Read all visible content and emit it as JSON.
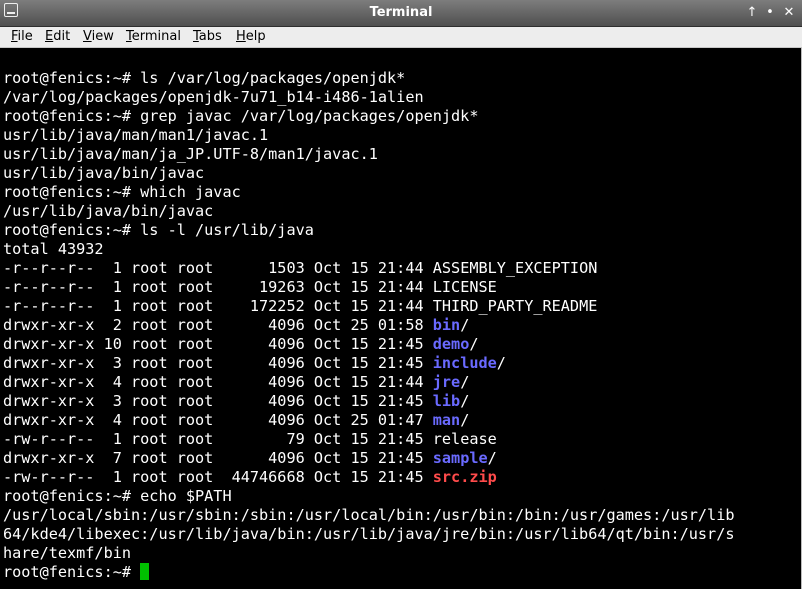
{
  "window": {
    "title": "Terminal",
    "controls": {
      "up": "↑",
      "restore": "•",
      "close": "✕"
    }
  },
  "menu": [
    {
      "label_u": "F",
      "label_rest": "ile"
    },
    {
      "label_u": "E",
      "label_rest": "dit"
    },
    {
      "label_u": "V",
      "label_rest": "iew"
    },
    {
      "label_u": "T",
      "label_rest": "erminal"
    },
    {
      "label_u": "T",
      "label_rest": "abs"
    },
    {
      "label_u": "H",
      "label_rest": "elp"
    }
  ],
  "terminal": {
    "prompt": "root@fenics:~# ",
    "lines": [
      {
        "t": "root@fenics:~# ls /var/log/packages/openjdk*"
      },
      {
        "t": "/var/log/packages/openjdk-7u71_b14-i486-1alien"
      },
      {
        "t": "root@fenics:~# grep javac /var/log/packages/openjdk*"
      },
      {
        "t": "usr/lib/java/man/man1/javac.1"
      },
      {
        "t": "usr/lib/java/man/ja_JP.UTF-8/man1/javac.1"
      },
      {
        "t": "usr/lib/java/bin/javac"
      },
      {
        "t": "root@fenics:~# which javac"
      },
      {
        "t": "/usr/lib/java/bin/javac"
      },
      {
        "t": "root@fenics:~# ls -l /usr/lib/java"
      },
      {
        "t": "total 43932"
      },
      {
        "pre": "-r--r--r--  1 root root      1503 Oct 15 21:44 ",
        "name": "ASSEMBLY_EXCEPTION",
        "kind": "file"
      },
      {
        "pre": "-r--r--r--  1 root root     19263 Oct 15 21:44 ",
        "name": "LICENSE",
        "kind": "file"
      },
      {
        "pre": "-r--r--r--  1 root root    172252 Oct 15 21:44 ",
        "name": "THIRD_PARTY_README",
        "kind": "file"
      },
      {
        "pre": "drwxr-xr-x  2 root root      4096 Oct 25 01:58 ",
        "name": "bin",
        "kind": "dir"
      },
      {
        "pre": "drwxr-xr-x 10 root root      4096 Oct 15 21:45 ",
        "name": "demo",
        "kind": "dir"
      },
      {
        "pre": "drwxr-xr-x  3 root root      4096 Oct 15 21:45 ",
        "name": "include",
        "kind": "dir"
      },
      {
        "pre": "drwxr-xr-x  4 root root      4096 Oct 15 21:44 ",
        "name": "jre",
        "kind": "dir"
      },
      {
        "pre": "drwxr-xr-x  3 root root      4096 Oct 15 21:45 ",
        "name": "lib",
        "kind": "dir"
      },
      {
        "pre": "drwxr-xr-x  4 root root      4096 Oct 25 01:47 ",
        "name": "man",
        "kind": "dir"
      },
      {
        "pre": "-rw-r--r--  1 root root        79 Oct 15 21:45 ",
        "name": "release",
        "kind": "file"
      },
      {
        "pre": "drwxr-xr-x  7 root root      4096 Oct 15 21:45 ",
        "name": "sample",
        "kind": "dir"
      },
      {
        "pre": "-rw-r--r--  1 root root  44746668 Oct 15 21:45 ",
        "name": "src.zip",
        "kind": "archive"
      },
      {
        "t": "root@fenics:~# echo $PATH"
      },
      {
        "t": "/usr/local/sbin:/usr/sbin:/sbin:/usr/local/bin:/usr/bin:/bin:/usr/games:/usr/lib"
      },
      {
        "t": "64/kde4/libexec:/usr/lib/java/bin:/usr/lib/java/jre/bin:/usr/lib64/qt/bin:/usr/s"
      },
      {
        "t": "hare/texmf/bin"
      },
      {
        "t": "root@fenics:~# ",
        "cursor": true
      }
    ]
  },
  "colors": {
    "dir": "#6a6aff",
    "archive": "#ff4b4b",
    "cursor": "#00c000"
  }
}
